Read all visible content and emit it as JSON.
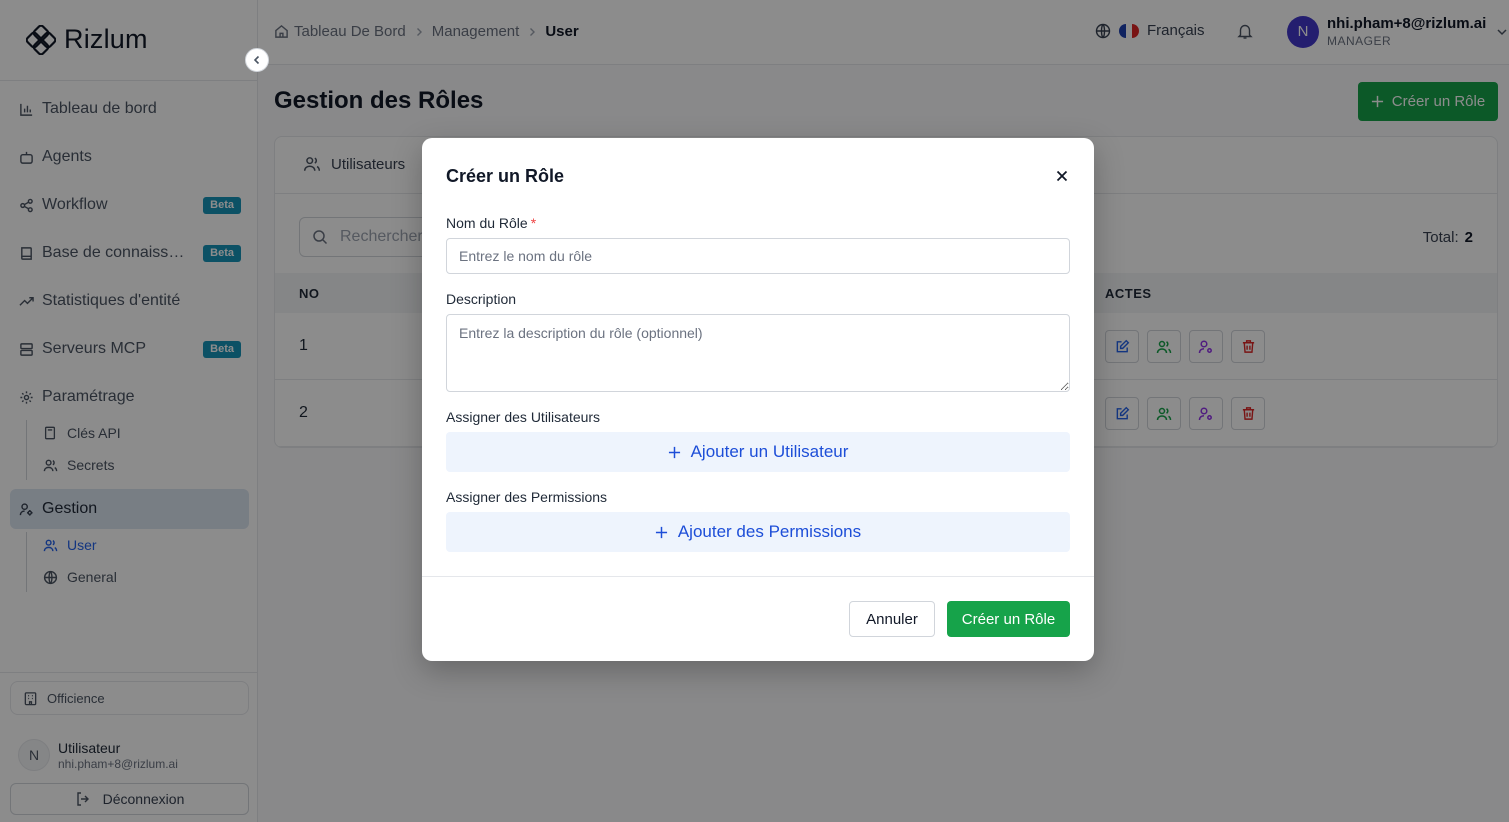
{
  "app": {
    "name": "Rizlum"
  },
  "colors": {
    "primary_green": "#16a34a",
    "beta_badge": "#1794b8",
    "link_blue": "#2563eb",
    "avatar": "#4338ca"
  },
  "sidebar": {
    "items": [
      {
        "label": "Tableau de bord",
        "icon": "bar-chart-icon"
      },
      {
        "label": "Agents",
        "icon": "bot-icon"
      },
      {
        "label": "Workflow",
        "icon": "share-nodes-icon",
        "badge": "Beta"
      },
      {
        "label": "Base de connaissances",
        "icon": "book-icon",
        "badge": "Beta"
      },
      {
        "label": "Statistiques d'entité",
        "icon": "trend-icon"
      },
      {
        "label": "Serveurs MCP",
        "icon": "server-icon",
        "badge": "Beta"
      },
      {
        "label": "Paramétrage",
        "icon": "gear-icon"
      },
      {
        "label": "Gestion",
        "icon": "user-cog-icon"
      }
    ],
    "settings_sub": [
      {
        "label": "Clés API",
        "icon": "calculator-icon"
      },
      {
        "label": "Secrets",
        "icon": "users-icon"
      }
    ],
    "management_sub": [
      {
        "label": "User",
        "icon": "users-icon"
      },
      {
        "label": "General",
        "icon": "globe-icon"
      }
    ],
    "organization": "Officience",
    "user": {
      "initial": "N",
      "name": "Utilisateur",
      "email": "nhi.pham+8@rizlum.ai"
    },
    "logout_label": "Déconnexion"
  },
  "header": {
    "breadcrumbs": [
      "Tableau De Bord",
      "Management",
      "User"
    ],
    "language": "Français",
    "user": {
      "initial": "N",
      "email": "nhi.pham+8@rizlum.ai",
      "role": "MANAGER"
    }
  },
  "page": {
    "title": "Gestion des Rôles",
    "create_button": "Créer un Rôle",
    "tab_label": "Utilisateurs",
    "search_placeholder": "Rechercher",
    "total_label": "Total:",
    "total_value": "2",
    "table": {
      "col_no": "NO",
      "col_actions": "ACTES",
      "rows": [
        {
          "no": "1"
        },
        {
          "no": "2"
        }
      ]
    }
  },
  "modal": {
    "title": "Créer un Rôle",
    "name_label": "Nom du Rôle",
    "required_mark": "*",
    "name_placeholder": "Entrez le nom du rôle",
    "description_label": "Description",
    "description_placeholder": "Entrez la description du rôle (optionnel)",
    "assign_users_label": "Assigner des Utilisateurs",
    "add_user_button": "Ajouter un Utilisateur",
    "assign_permissions_label": "Assigner des Permissions",
    "add_permissions_button": "Ajouter des Permissions",
    "cancel_button": "Annuler",
    "submit_button": "Créer un Rôle"
  }
}
